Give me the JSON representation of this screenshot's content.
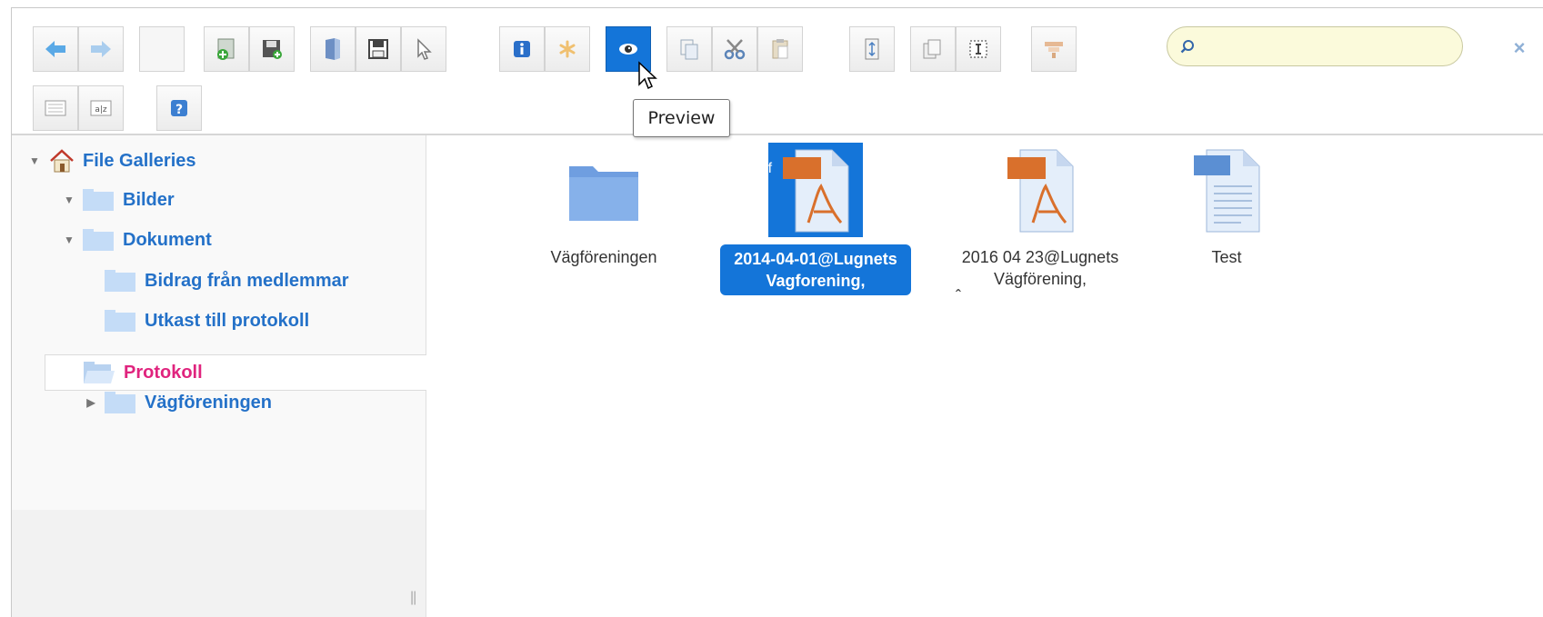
{
  "toolbar": {
    "row1": [
      {
        "name": "back-button",
        "icon": "arrow-left-icon"
      },
      {
        "name": "forward-button",
        "icon": "arrow-right-icon"
      },
      {
        "name": "blank-button",
        "icon": ""
      },
      {
        "name": "new-folder-button",
        "icon": "add-folder-icon"
      },
      {
        "name": "save-new-button",
        "icon": "save-add-icon"
      },
      {
        "name": "open-button",
        "icon": "open-book-icon"
      },
      {
        "name": "save-button",
        "icon": "floppy-icon"
      },
      {
        "name": "select-button",
        "icon": "cursor-icon"
      },
      {
        "name": "info-button",
        "icon": "info-icon"
      },
      {
        "name": "extract-button",
        "icon": "asterisk-icon"
      },
      {
        "name": "preview-button",
        "icon": "eye-icon",
        "active": true
      },
      {
        "name": "copy-button",
        "icon": "copy-icon"
      },
      {
        "name": "cut-button",
        "icon": "scissors-icon"
      },
      {
        "name": "paste-button",
        "icon": "paste-icon"
      },
      {
        "name": "archive-button",
        "icon": "archive-icon"
      },
      {
        "name": "duplicate-button",
        "icon": "duplicate-icon"
      },
      {
        "name": "rename-button",
        "icon": "rename-icon"
      },
      {
        "name": "edit-button",
        "icon": "edit-icon"
      }
    ],
    "row2": [
      {
        "name": "view-list-button",
        "icon": "list-view-icon"
      },
      {
        "name": "sort-button",
        "icon": "sort-az-icon"
      },
      {
        "name": "help-button",
        "icon": "help-icon"
      }
    ],
    "tooltip": "Preview",
    "search": {
      "placeholder": "",
      "value": ""
    },
    "clear_label": "×"
  },
  "sidebar": {
    "root": "File Galleries",
    "items": [
      {
        "label": "Bilder",
        "expanded": true
      },
      {
        "label": "Dokument",
        "expanded": true
      },
      {
        "label": "Bidrag från medlemmar"
      },
      {
        "label": "Utkast till protokoll"
      },
      {
        "label": "Protokoll",
        "selected": true
      },
      {
        "label": "Vägföreningen",
        "expanded": false
      }
    ],
    "resize_handle": "||"
  },
  "files": [
    {
      "name": "Vägföreningen",
      "type": "folder"
    },
    {
      "name": "2014-04-01@Lugnets Vagforening,",
      "line1": "2014-04-01@Lugnets",
      "line2": "Vagforening,",
      "type": "pdf",
      "badge": "pdf",
      "selected": true
    },
    {
      "name": "2016 04 23@Lugnets Vägförening,",
      "line1": "2016 04 23@Lugnets",
      "line2": "Vägförening,",
      "type": "pdf",
      "badge": "pdf",
      "caret": "ˆ"
    },
    {
      "name": "Test",
      "type": "txt",
      "badge": "txt"
    }
  ],
  "colors": {
    "accent": "#1475d9",
    "link": "#2471c8",
    "selected_tree": "#e0247e",
    "pdf_badge": "#d9702c",
    "txt_badge": "#5b8fd3",
    "search_bg": "#fbfadb"
  }
}
